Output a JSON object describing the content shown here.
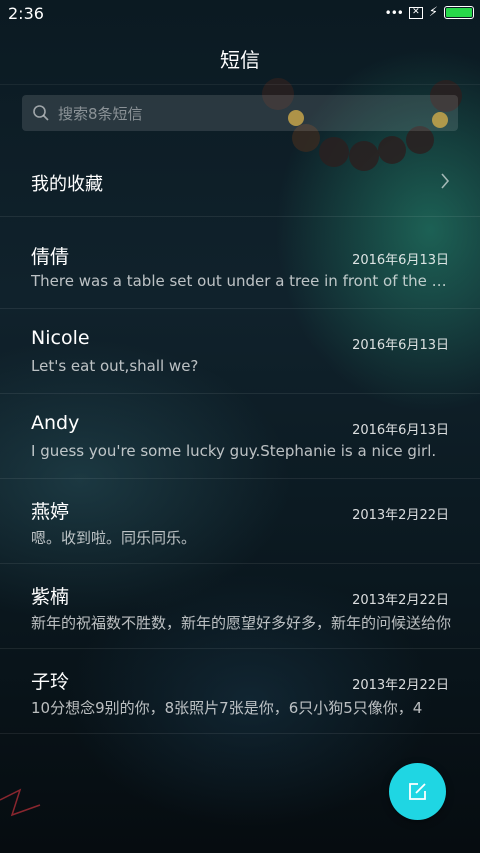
{
  "status_bar": {
    "time": "2:36",
    "signal_dots": "•••"
  },
  "header": {
    "title": "短信"
  },
  "search": {
    "placeholder": "搜索8条短信"
  },
  "favorites": {
    "label": "我的收藏"
  },
  "conversations": [
    {
      "name": "倩倩",
      "date": "2016年6月13日",
      "preview": "There was a table set out under a tree in front of the house, and the March Hare and the Hatter were having tea at it"
    },
    {
      "name": "Nicole",
      "date": "2016年6月13日",
      "preview": "Let's eat out,shall we?"
    },
    {
      "name": "Andy",
      "date": "2016年6月13日",
      "preview": "I guess you're some lucky guy.Stephanie is a nice girl."
    },
    {
      "name": "燕婷",
      "date": "2013年2月22日",
      "preview": "嗯。收到啦。同乐同乐。"
    },
    {
      "name": "紫楠",
      "date": "2013年2月22日",
      "preview": "新年的祝福数不胜数，新年的愿望好多好多，新年的问候送给你"
    },
    {
      "name": "子玲",
      "date": "2013年2月22日",
      "preview": "10分想念9别的你，8张照片7张是你，6只小狗5只像你，4"
    }
  ],
  "colors": {
    "accent": "#1fd6e3",
    "battery": "#27d84a"
  }
}
